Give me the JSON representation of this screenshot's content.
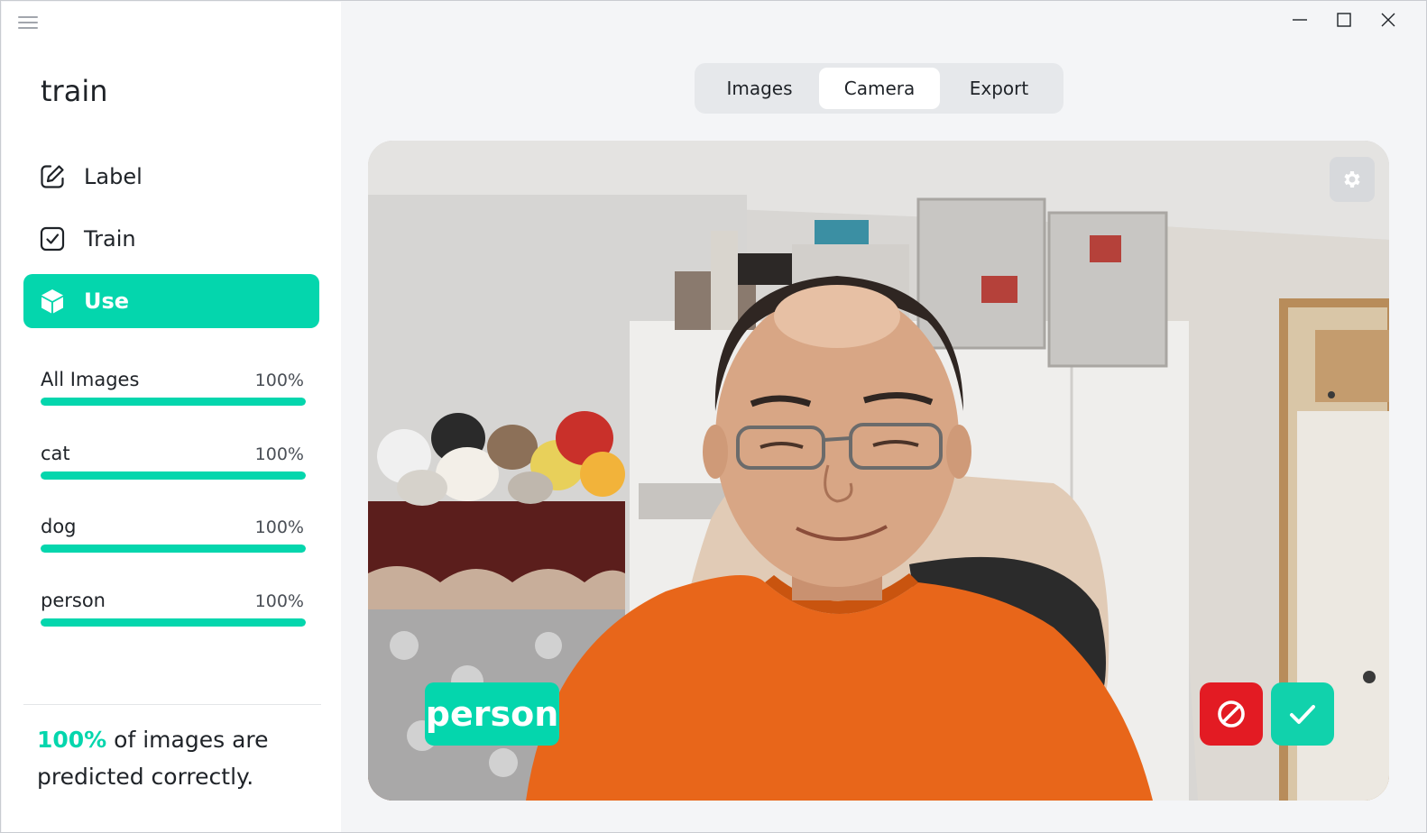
{
  "window": {
    "controls": [
      "minimize-icon",
      "maximize-icon",
      "close-icon"
    ]
  },
  "sidebar": {
    "project_title": "train",
    "nav": [
      {
        "label": "Label",
        "icon": "edit-icon",
        "active": false
      },
      {
        "label": "Train",
        "icon": "checkbox-icon",
        "active": true
      },
      {
        "label": "Use",
        "icon": "cube-icon",
        "active": true
      }
    ],
    "stats": [
      {
        "name": "All Images",
        "percent_label": "100%",
        "percent": 100
      },
      {
        "name": "cat",
        "percent_label": "100%",
        "percent": 100
      },
      {
        "name": "dog",
        "percent_label": "100%",
        "percent": 100
      },
      {
        "name": "person",
        "percent_label": "100%",
        "percent": 100
      }
    ],
    "summary": {
      "accent": "100%",
      "text": " of images are predicted correctly."
    }
  },
  "tabs": [
    {
      "label": "Images",
      "selected": false
    },
    {
      "label": "Camera",
      "selected": true
    },
    {
      "label": "Export",
      "selected": false
    }
  ],
  "camera": {
    "prediction": "person",
    "settings_icon": "gear-icon",
    "wrong_icon": "ban-icon",
    "correct_icon": "check-icon"
  },
  "colors": {
    "accent": "#04d6ad",
    "danger": "#e31b23",
    "sidebar_bg": "#ffffff",
    "main_bg": "#f4f5f7"
  }
}
